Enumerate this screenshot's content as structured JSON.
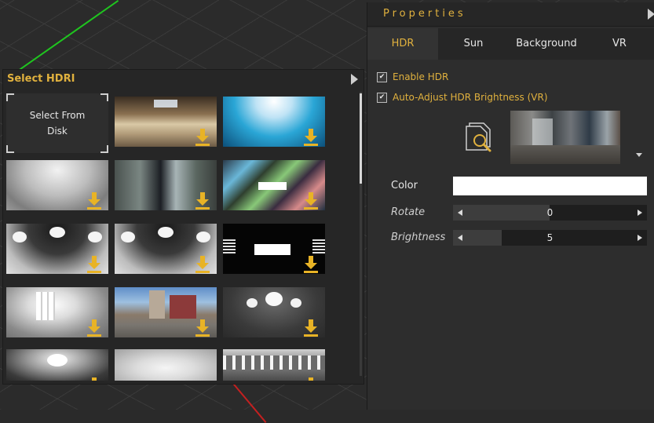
{
  "properties": {
    "title": "Properties",
    "tabs": [
      {
        "label": "HDR",
        "active": true
      },
      {
        "label": "Sun",
        "active": false
      },
      {
        "label": "Background",
        "active": false
      },
      {
        "label": "VR",
        "active": false
      }
    ],
    "enable_hdr": {
      "label": "Enable HDR",
      "checked": true
    },
    "auto_adjust": {
      "label": "Auto-Adjust HDR Brightness (VR)",
      "checked": true
    },
    "color": {
      "label": "Color",
      "value": "#ffffff"
    },
    "rotate": {
      "label": "Rotate",
      "value": "0"
    },
    "brightness": {
      "label": "Brightness",
      "value": "5"
    }
  },
  "hdri_panel": {
    "title": "Select HDRI",
    "select_from_disk": "Select From Disk"
  },
  "colors": {
    "accent": "#e0b13e",
    "panel": "#2d2d2d",
    "header": "#262626"
  }
}
